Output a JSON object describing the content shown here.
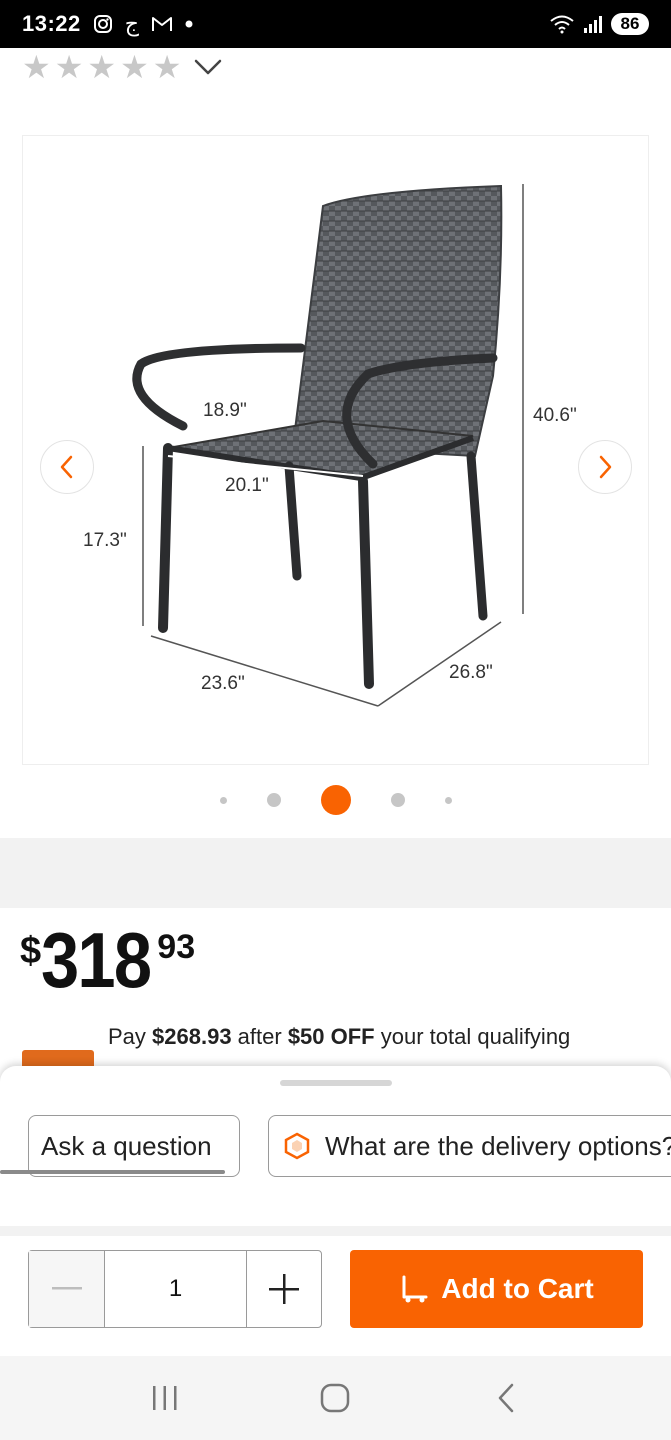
{
  "status_bar": {
    "time": "13:22",
    "left_icons": [
      "instagram-icon",
      "arabic-app-icon",
      "gmail-icon",
      "dot-icon"
    ],
    "arabic_glyph": "ج",
    "battery": "86"
  },
  "rating": {
    "stars_filled": 0,
    "stars_total": 5,
    "star_char": "★"
  },
  "gallery": {
    "dimensions": {
      "top_depth": "18.9\"",
      "seat_width": "20.1\"",
      "height": "40.6\"",
      "seat_height": "17.3\"",
      "base_width": "23.6\"",
      "base_depth": "26.8\""
    },
    "active_index": 2,
    "dot_count": 5
  },
  "price": {
    "dollar": "$",
    "main": "318",
    "cents": "93"
  },
  "promo": {
    "prefix": "Pay ",
    "amount": "$268.93",
    "mid": " after ",
    "discount": "$50 OFF",
    "suffix": " your total qualifying"
  },
  "sheet": {
    "ask_label": "Ask a question",
    "delivery_label": "What are the delivery options?"
  },
  "cart": {
    "quantity": "1",
    "minus_symbol": "−",
    "plus_symbol": "+",
    "add_label": "Add to Cart"
  },
  "colors": {
    "accent": "#f96302",
    "star_inactive": "#c8c8c8"
  }
}
